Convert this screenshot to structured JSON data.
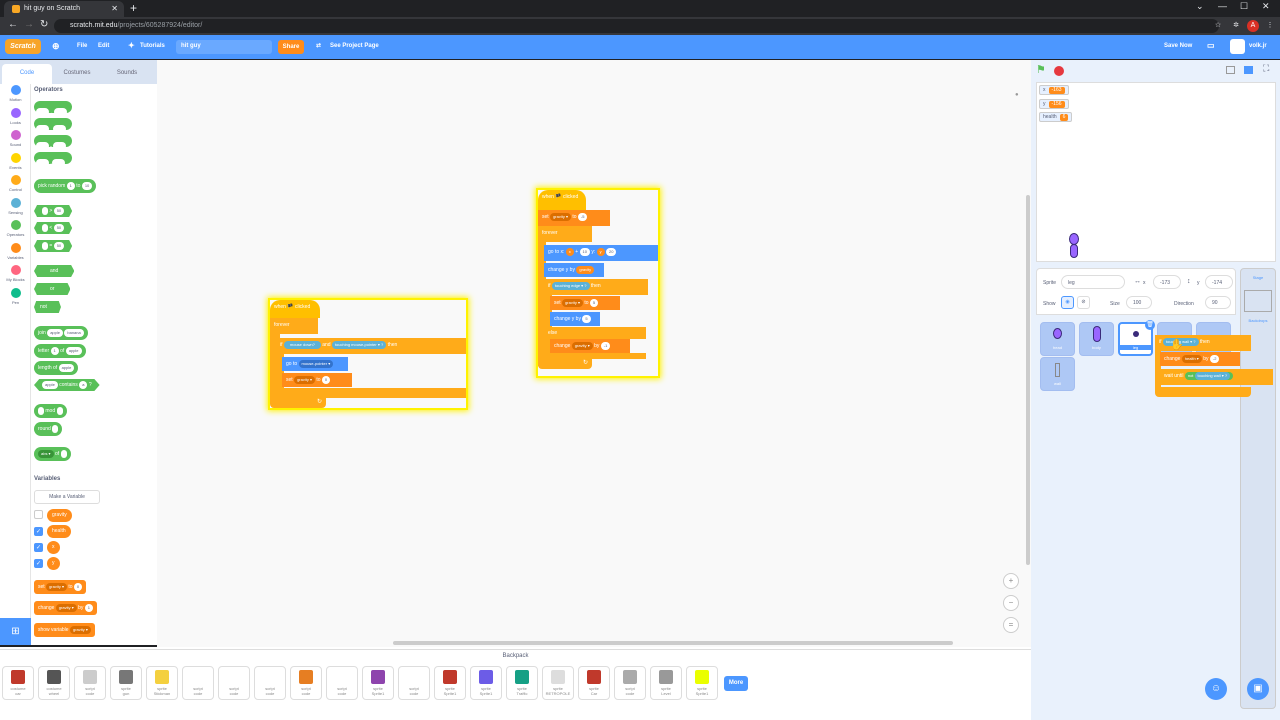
{
  "browser": {
    "tab_title": "hit guy on Scratch",
    "url_host": "scratch.mit.edu",
    "url_path": "/projects/605287924/editor/",
    "profile_initial": "A"
  },
  "menu": {
    "logo": "Scratch",
    "file": "File",
    "edit": "Edit",
    "tutorials": "Tutorials",
    "project_title": "hit guy",
    "share": "Share",
    "see_project": "See Project Page",
    "save": "Save Now",
    "user": "volk.jr"
  },
  "tabs": {
    "code": "Code",
    "costumes": "Costumes",
    "sounds": "Sounds"
  },
  "categories": [
    {
      "label": "Motion",
      "color": "#4c97ff"
    },
    {
      "label": "Looks",
      "color": "#9966ff"
    },
    {
      "label": "Sound",
      "color": "#cf63cf"
    },
    {
      "label": "Events",
      "color": "#ffd500"
    },
    {
      "label": "Control",
      "color": "#ffab19"
    },
    {
      "label": "Sensing",
      "color": "#5cb1d6"
    },
    {
      "label": "Operators",
      "color": "#59c059"
    },
    {
      "label": "Variables",
      "color": "#ff8c1a"
    },
    {
      "label": "My Blocks",
      "color": "#ff6680"
    },
    {
      "label": "Pen",
      "color": "#0fbd8c"
    }
  ],
  "palette": {
    "title": "Operators",
    "arith": [
      "+",
      "-",
      "*",
      "/"
    ],
    "pick": {
      "label": "pick random",
      "a": "1",
      "to": "to",
      "b": "10"
    },
    "compare": [
      {
        "op": ">",
        "v": "50"
      },
      {
        "op": "<",
        "v": "50"
      },
      {
        "op": "=",
        "v": "50"
      }
    ],
    "logic": [
      "and",
      "or",
      "not"
    ],
    "join": {
      "label": "join",
      "a": "apple",
      "b": "banana"
    },
    "letter": {
      "label": "letter",
      "n": "1",
      "of": "of",
      "w": "apple"
    },
    "length": {
      "label": "length of",
      "w": "apple"
    },
    "contains": {
      "w": "apple",
      "label": "contains",
      "c": "a",
      "q": "?"
    },
    "mod": "mod",
    "round": "round",
    "abs": {
      "label": "abs ▾",
      "of": "of"
    },
    "variables_title": "Variables",
    "make_var": "Make a Variable",
    "vars": [
      {
        "name": "gravity",
        "checked": false
      },
      {
        "name": "health",
        "checked": true
      },
      {
        "name": "x",
        "checked": true
      },
      {
        "name": "y",
        "checked": true
      }
    ],
    "set": {
      "label": "set",
      "var": "gravity ▾",
      "to": "to",
      "v": "0"
    },
    "change": {
      "label": "change",
      "var": "gravity ▾",
      "by": "by",
      "v": "1"
    },
    "show": {
      "label": "show variable",
      "var": "gravity ▾"
    }
  },
  "script1": {
    "hat": "when 🏴 clicked",
    "forever": "forever",
    "if": "if",
    "mouse_down": "mouse down?",
    "and": "and",
    "touching": "touching",
    "mouse_pointer": "mouse-pointer ▾",
    "q": "?",
    "then": "then",
    "goto": "go to",
    "goto_target": "mouse-pointer ▾",
    "set": "set",
    "var": "gravity ▾",
    "to": "to",
    "val": "0"
  },
  "script2": {
    "hat": "when 🏴 clicked",
    "set": "set",
    "var": "gravity ▾",
    "to": "to",
    "set_val": "-5",
    "forever": "forever",
    "goto": "go to x:",
    "x": "x",
    "plus": "+",
    "xv": "10",
    "y": "y:",
    "yv": "20",
    "y_kw": "y",
    "change_y": "change y by",
    "gravity": "gravity",
    "if": "if",
    "touching": "touching",
    "edge": "edge ▾",
    "q": "?",
    "then": "then",
    "set_val2": "5",
    "change_y2": "change y by",
    "cy_val": "5",
    "else": "else",
    "change": "change",
    "by": "by",
    "change_val": "-1"
  },
  "dragged": {
    "if": "if",
    "touching": "touching",
    "wall": "wall ▾",
    "q": "?",
    "then": "then",
    "change": "change",
    "health": "health ▾",
    "by": "by",
    "val": "-2",
    "wait": "wait until",
    "not": "not",
    "touching2": "touching",
    "wall2": "wall ▾",
    "q2": "?"
  },
  "monitors": [
    {
      "name": "x",
      "value": "-163"
    },
    {
      "name": "y",
      "value": "-156"
    },
    {
      "name": "health",
      "value": "6"
    }
  ],
  "sprite_info": {
    "sprite_label": "Sprite",
    "sprite_name": "leg",
    "x_label": "x",
    "x": "-173",
    "y_label": "y",
    "y": "-174",
    "show": "Show",
    "size_label": "Size",
    "size": "100",
    "dir_label": "Direction",
    "dir": "90"
  },
  "sprites": [
    {
      "name": "head"
    },
    {
      "name": "body"
    },
    {
      "name": "leg"
    },
    {
      "name": "wall"
    }
  ],
  "stage_col": {
    "label": "Stage",
    "backdrops": "Backdrops"
  },
  "backpack": {
    "title": "Backpack",
    "more": "More",
    "items": [
      {
        "top": "costume",
        "bot": "car",
        "color": "#c0392b"
      },
      {
        "top": "costume",
        "bot": "wheel",
        "color": "#555555"
      },
      {
        "top": "script",
        "bot": "code",
        "color": "#cccccc"
      },
      {
        "top": "sprite",
        "bot": "gun",
        "color": "#777777"
      },
      {
        "top": "sprite",
        "bot": "Stickman",
        "color": "#f4d03f"
      },
      {
        "top": "script",
        "bot": "code",
        "color": "#ffffff"
      },
      {
        "top": "script",
        "bot": "code",
        "color": "#ffffff"
      },
      {
        "top": "script",
        "bot": "code",
        "color": "#ffffff"
      },
      {
        "top": "script",
        "bot": "code",
        "color": "#e67e22"
      },
      {
        "top": "script",
        "bot": "code",
        "color": "#ffffff"
      },
      {
        "top": "sprite",
        "bot": "Sprite1",
        "color": "#8e44ad"
      },
      {
        "top": "script",
        "bot": "code",
        "color": "#ffffff"
      },
      {
        "top": "sprite",
        "bot": "Sprite1",
        "color": "#c0392b"
      },
      {
        "top": "sprite",
        "bot": "Sprite1",
        "color": "#6c5ce7"
      },
      {
        "top": "sprite",
        "bot": "Traffic",
        "color": "#16a085"
      },
      {
        "top": "sprite",
        "bot": "RETROPOLE",
        "color": "#dddddd"
      },
      {
        "top": "sprite",
        "bot": "Car",
        "color": "#c0392b"
      },
      {
        "top": "script",
        "bot": "code",
        "color": "#aaaaaa"
      },
      {
        "top": "sprite",
        "bot": "Level",
        "color": "#999999"
      },
      {
        "top": "sprite",
        "bot": "Sprite1",
        "color": "#eaff00"
      }
    ]
  }
}
